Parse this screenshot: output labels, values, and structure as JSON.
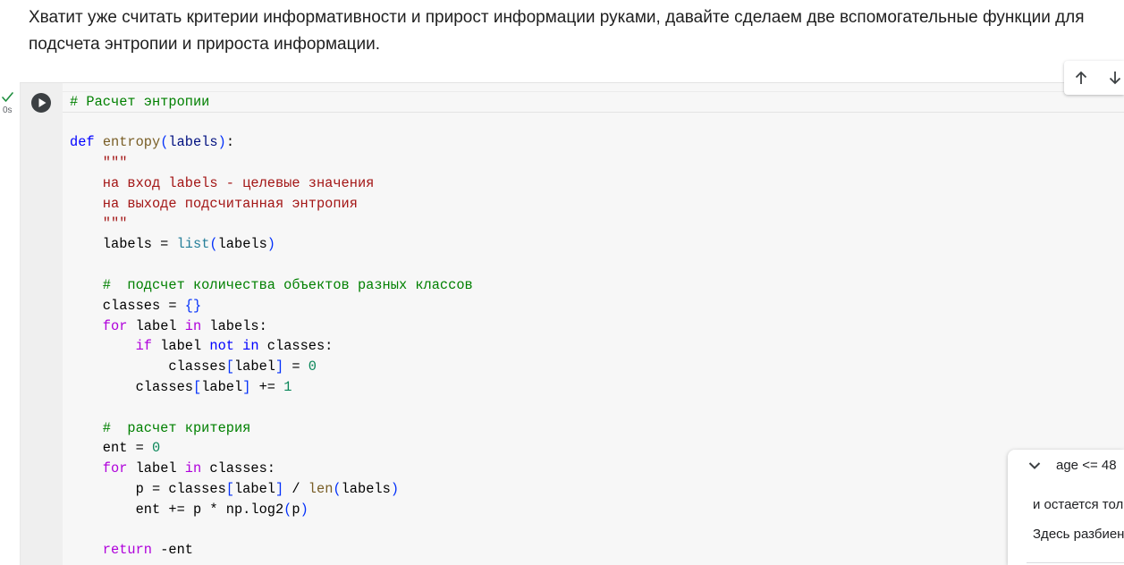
{
  "markdown_cell": {
    "text": "Хватит уже считать критерии информативности и прирост информации руками, давайте сделаем две вспомогательные функции для подсчета энтропии и прироста информации."
  },
  "cell_toolbar": {
    "move_up_icon": "arrow-up-icon",
    "move_down_icon": "arrow-down-icon"
  },
  "code_cell": {
    "status_icon": "check-icon",
    "status_color": "#1e8e3e",
    "execution_time": "0s",
    "run_icon": "play-circle-icon",
    "lines": [
      [
        [
          "# Расчет энтропии",
          "#008000"
        ]
      ],
      [],
      [
        [
          "def",
          "#0000ff"
        ],
        [
          " ",
          "#000000"
        ],
        [
          "entropy",
          "#795e26"
        ],
        [
          "(",
          "#0431fa"
        ],
        [
          "labels",
          "#001080"
        ],
        [
          ")",
          "#0431fa"
        ],
        [
          ":",
          "#000000"
        ]
      ],
      [
        [
          "    ",
          "#000000"
        ],
        [
          "\"\"\"",
          "#a31515"
        ]
      ],
      [
        [
          "    ",
          "#000000"
        ],
        [
          "на вход labels - целевые значения",
          "#a31515"
        ]
      ],
      [
        [
          "    ",
          "#000000"
        ],
        [
          "на выходе подсчитанная энтропия",
          "#a31515"
        ]
      ],
      [
        [
          "    ",
          "#000000"
        ],
        [
          "\"\"\"",
          "#a31515"
        ]
      ],
      [
        [
          "    labels = ",
          "#000000"
        ],
        [
          "list",
          "#267f99"
        ],
        [
          "(",
          "#0431fa"
        ],
        [
          "labels",
          "#000000"
        ],
        [
          ")",
          "#0431fa"
        ]
      ],
      [],
      [
        [
          "    ",
          "#000000"
        ],
        [
          "#  подсчет количества объектов разных классов",
          "#008000"
        ]
      ],
      [
        [
          "    classes = ",
          "#000000"
        ],
        [
          "{}",
          "#0431fa"
        ]
      ],
      [
        [
          "    ",
          "#000000"
        ],
        [
          "for",
          "#af00db"
        ],
        [
          " label ",
          "#000000"
        ],
        [
          "in",
          "#af00db"
        ],
        [
          " labels:",
          "#000000"
        ]
      ],
      [
        [
          "        ",
          "#000000"
        ],
        [
          "if",
          "#af00db"
        ],
        [
          " label ",
          "#000000"
        ],
        [
          "not in",
          "#0000ff"
        ],
        [
          " classes:",
          "#000000"
        ]
      ],
      [
        [
          "            classes",
          "#000000"
        ],
        [
          "[",
          "#0431fa"
        ],
        [
          "label",
          "#000000"
        ],
        [
          "]",
          "#0431fa"
        ],
        [
          " = ",
          "#000000"
        ],
        [
          "0",
          "#098658"
        ]
      ],
      [
        [
          "        classes",
          "#000000"
        ],
        [
          "[",
          "#0431fa"
        ],
        [
          "label",
          "#000000"
        ],
        [
          "]",
          "#0431fa"
        ],
        [
          " += ",
          "#000000"
        ],
        [
          "1",
          "#098658"
        ]
      ],
      [],
      [
        [
          "    ",
          "#000000"
        ],
        [
          "#  расчет критерия",
          "#008000"
        ]
      ],
      [
        [
          "    ent = ",
          "#000000"
        ],
        [
          "0",
          "#098658"
        ]
      ],
      [
        [
          "    ",
          "#000000"
        ],
        [
          "for",
          "#af00db"
        ],
        [
          " label ",
          "#000000"
        ],
        [
          "in",
          "#af00db"
        ],
        [
          " classes:",
          "#000000"
        ]
      ],
      [
        [
          "        p = classes",
          "#000000"
        ],
        [
          "[",
          "#0431fa"
        ],
        [
          "label",
          "#000000"
        ],
        [
          "]",
          "#0431fa"
        ],
        [
          " / ",
          "#000000"
        ],
        [
          "len",
          "#795e26"
        ],
        [
          "(",
          "#0431fa"
        ],
        [
          "labels",
          "#000000"
        ],
        [
          ")",
          "#0431fa"
        ]
      ],
      [
        [
          "        ent += p * np.log2",
          "#000000"
        ],
        [
          "(",
          "#0431fa"
        ],
        [
          "p",
          "#000000"
        ],
        [
          ")",
          "#0431fa"
        ]
      ],
      [],
      [
        [
          "    ",
          "#000000"
        ],
        [
          "return",
          "#af00db"
        ],
        [
          " -ent",
          "#000000"
        ]
      ]
    ]
  },
  "floating_panel": {
    "toggle_icon": "chevron-down-icon",
    "title": "age <= 48",
    "lines": [
      "и остается тол",
      "Здесь разбиен"
    ]
  }
}
